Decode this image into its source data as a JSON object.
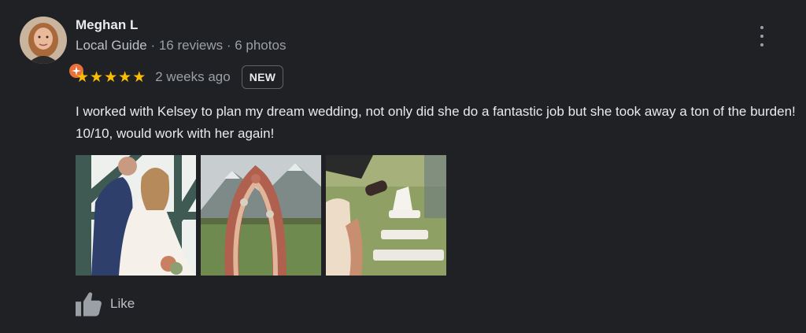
{
  "reviewer": {
    "name": "Meghan L",
    "guide_label": "Local Guide",
    "separator": " · ",
    "reviews": "16 reviews",
    "photos": "6 photos"
  },
  "rating": {
    "stars": 5,
    "max_stars": 5,
    "star_glyph": "★",
    "time_ago": "2 weeks ago",
    "badge": "NEW"
  },
  "review_text": "I worked with Kelsey to plan my dream wedding, not only did she do a fantastic job but she took away a ton of the burden! 10/10, would work with her again!",
  "photos": [
    {
      "icon": "wedding-couple-photo"
    },
    {
      "icon": "floral-arch-photo"
    },
    {
      "icon": "champagne-tower-photo"
    }
  ],
  "actions": {
    "like_label": "Like",
    "like_icon": "thumbs-up-icon",
    "more_icon": "more-vert-icon"
  },
  "colors": {
    "background": "#202124",
    "star": "#fbbc04",
    "guide_badge": "#e8713b",
    "primary_text": "#e8eaed",
    "secondary_text": "#9aa0a6"
  }
}
